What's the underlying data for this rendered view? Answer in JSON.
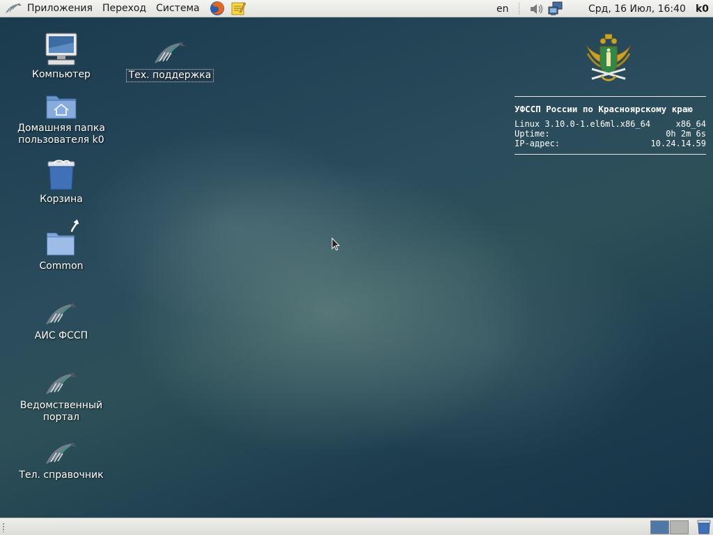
{
  "top_panel": {
    "menus": [
      "Приложения",
      "Переход",
      "Система"
    ],
    "language": "en",
    "clock": "Срд, 16 Июл, 16:40",
    "user": "k0"
  },
  "desktop_icons": {
    "computer": "Компьютер",
    "tech_support": "Тех. поддержка",
    "home_line1": "Домашняя папка",
    "home_line2": "пользователя k0",
    "trash": "Корзина",
    "common": "Common",
    "ais": "АИС ФССП",
    "portal_line1": "Ведомственный",
    "portal_line2": "портал",
    "phonebook": "Тел. справочник"
  },
  "sysinfo": {
    "title": "УФССП России по Красноярскому краю",
    "kernel": "Linux 3.10.0-1.el6ml.x86_64",
    "arch": "x86_64",
    "uptime_label": "Uptime:",
    "uptime_value": "0h 2m 6s",
    "ip_label": "IP-адрес:",
    "ip_value": "10.24.14.59"
  },
  "colors": {
    "panel_bg": "#e8e8e6",
    "workspace_active": "#4f78a8",
    "desktop_bg": "#23465a"
  }
}
